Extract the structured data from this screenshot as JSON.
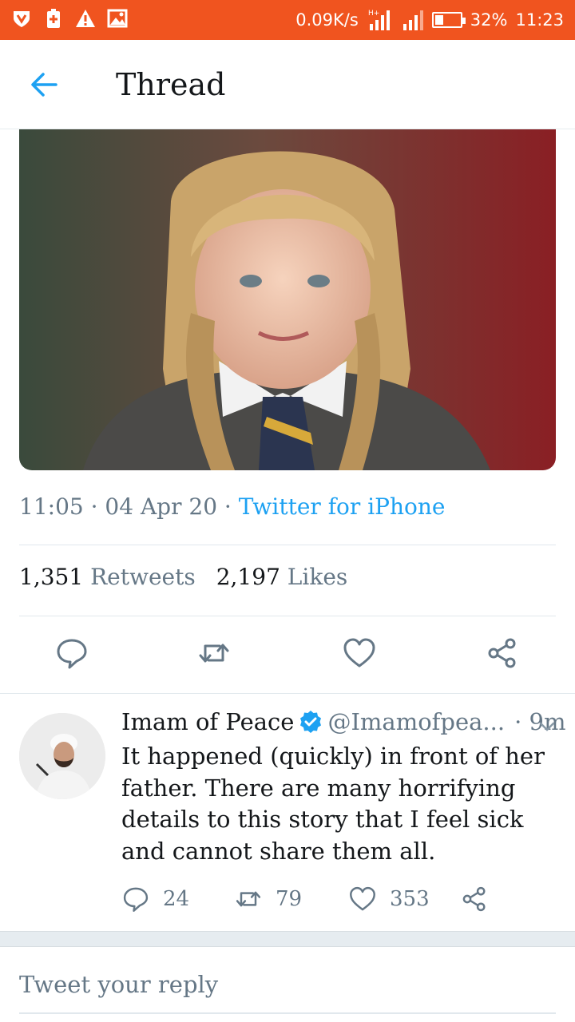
{
  "status_bar": {
    "net_speed": "0.09K/s",
    "network_type": "H+",
    "battery_percent": "32%",
    "battery_level": 0.32,
    "time": "11:23",
    "icons": [
      "vpn-shield-icon",
      "battery-saver-icon",
      "warning-icon",
      "image-icon",
      "signal-icon",
      "signal-icon",
      "battery-icon"
    ],
    "color": "#f0541f"
  },
  "header": {
    "title": "Thread",
    "back_icon": "arrow-left-icon"
  },
  "tweet": {
    "time": "11:05",
    "date": "04 Apr 20",
    "source": "Twitter for iPhone",
    "retweets_count": "1,351",
    "retweets_label": "Retweets",
    "likes_count": "2,197",
    "likes_label": "Likes",
    "actions": [
      "reply-icon",
      "retweet-icon",
      "like-icon",
      "share-icon"
    ]
  },
  "reply": {
    "name": "Imam of Peace",
    "handle": "@Imamofpea...",
    "time": "· 9m",
    "text": "It happened (quickly) in front of her father. There are many horrifying details to this story that I feel sick and cannot share them all.",
    "replies": "24",
    "retweets": "79",
    "likes": "353"
  },
  "composer": {
    "placeholder": "Tweet your reply"
  },
  "colors": {
    "accent": "#1da1f2",
    "muted": "#657786",
    "text": "#14171a"
  }
}
